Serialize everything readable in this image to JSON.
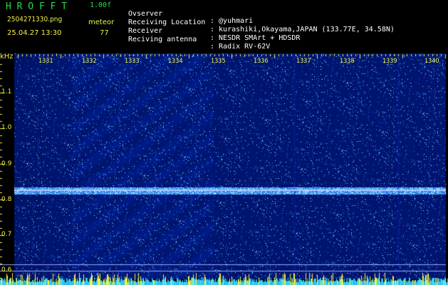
{
  "header": {
    "logo": "H R O F F T",
    "version": "1.00f",
    "filename": "2504271330.png",
    "mode": "meteor",
    "datetime": "25.04.27 13:30",
    "count": "77"
  },
  "station": [
    {
      "label": "Ovserver",
      "value": ": @yuhmari"
    },
    {
      "label": "Receiving Location",
      "value": ": kurashiki,Okayama,JAPAN (133.77E, 34.58N)"
    },
    {
      "label": "Receiver",
      "value": ": NESDR SMArt + HDSDR"
    },
    {
      "label": "Reciving antenna",
      "value": ": Radix RV-62V"
    }
  ],
  "axis": {
    "unit": "kHz",
    "y_ticks": [
      "1.1",
      "1.0",
      "0.9",
      "0.8",
      "0.7",
      "0.6"
    ],
    "x_ticks": [
      "1331",
      "1332",
      "1333",
      "1334",
      "1335",
      "1336",
      "1337",
      "1338",
      "1339",
      "1340"
    ]
  },
  "colors": {
    "background": "#000000",
    "plot": "#05127a",
    "carrier": "#7fd8ff",
    "label": "#f2f246",
    "logo": "#29d94a"
  }
}
